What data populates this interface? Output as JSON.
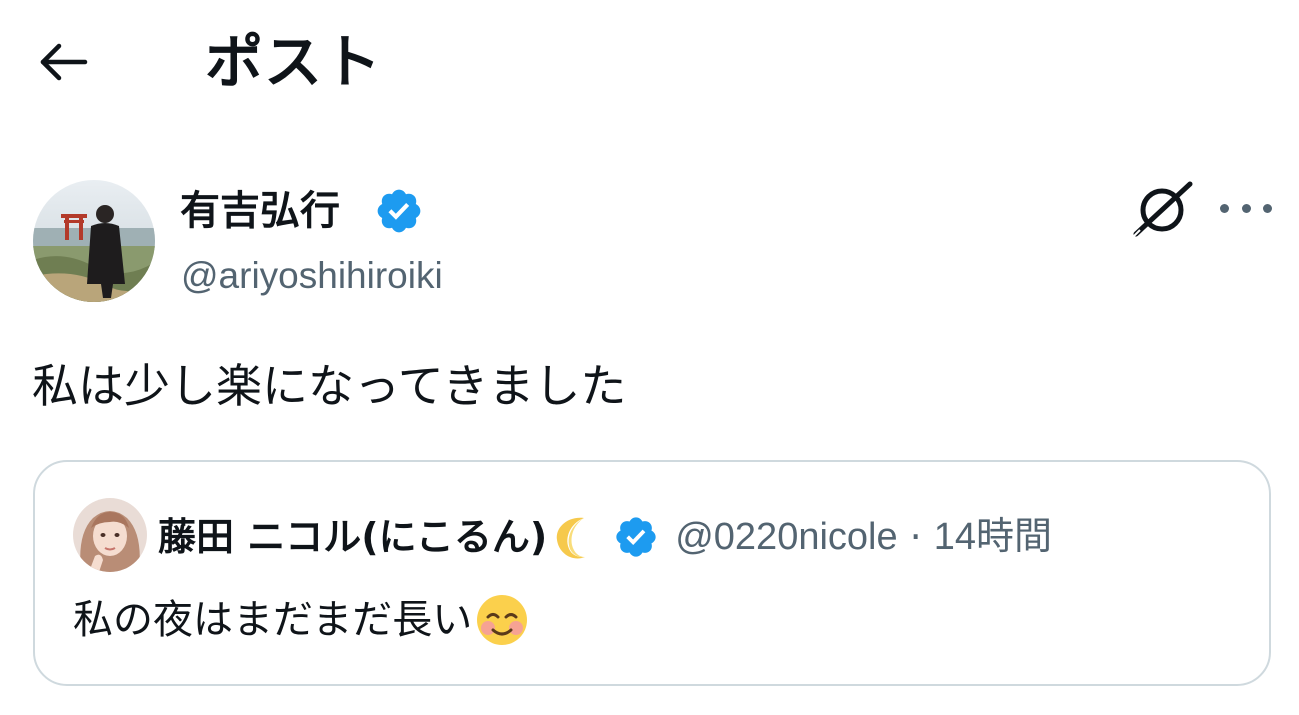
{
  "header": {
    "back_icon": "arrow-left-icon",
    "title": "ポスト"
  },
  "post": {
    "author": {
      "name": "有吉弘行",
      "handle": "@ariyoshihiroiki",
      "verified": true
    },
    "actions": {
      "grok_icon": "grok-icon",
      "more_icon": "more-horizontal-icon"
    },
    "text": "私は少し楽になってきました",
    "quote": {
      "author": {
        "name": "藤田 ニコル(にこるん)",
        "name_emoji": "crescent-moon-emoji",
        "verified": true,
        "handle": "@0220nicole",
        "separator": "·",
        "time": "14時間"
      },
      "text": "私の夜はまだまだ長い",
      "text_emoji": "smiling-face-emoji"
    }
  },
  "colors": {
    "text_primary": "#0f1419",
    "text_secondary": "#536471",
    "verified_blue": "#1d9bf0",
    "card_border": "#cfd9de"
  }
}
